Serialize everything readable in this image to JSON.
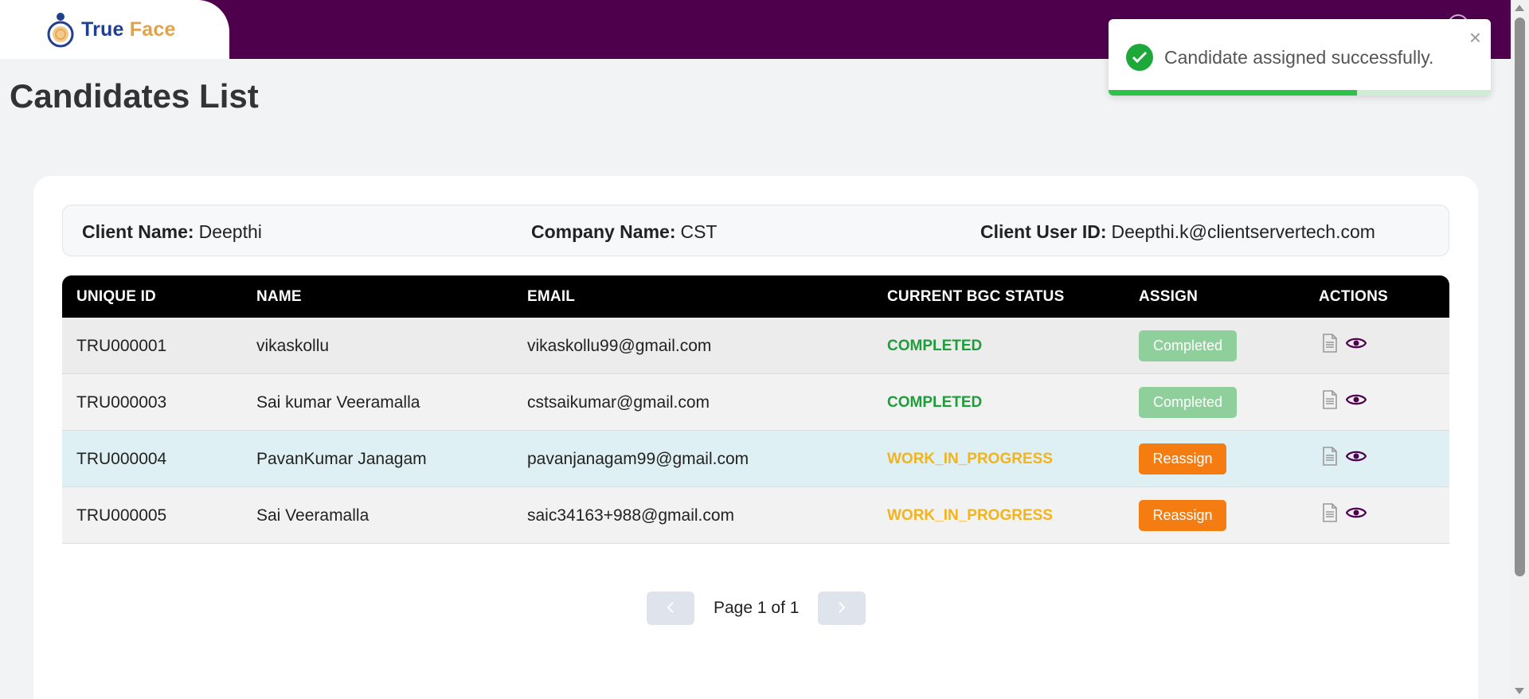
{
  "header": {
    "logo_true": "True",
    "logo_face": "Face"
  },
  "page_title": "Candidates List",
  "client_info": {
    "client_name_label": "Client Name:",
    "client_name": "Deepthi",
    "company_name_label": "Company Name:",
    "company_name": "CST",
    "client_user_id_label": "Client User ID:",
    "client_user_id": "Deepthi.k@clientservertech.com"
  },
  "table": {
    "columns": [
      "UNIQUE ID",
      "NAME",
      "EMAIL",
      "CURRENT BGC STATUS",
      "ASSIGN",
      "ACTIONS"
    ],
    "rows": [
      {
        "id": "TRU000001",
        "name": "vikaskollu",
        "email": "vikaskollu99@gmail.com",
        "status": "COMPLETED",
        "assign": "Completed"
      },
      {
        "id": "TRU000003",
        "name": "Sai kumar Veeramalla",
        "email": "cstsaikumar@gmail.com",
        "status": "COMPLETED",
        "assign": "Completed"
      },
      {
        "id": "TRU000004",
        "name": "PavanKumar Janagam",
        "email": "pavanjanagam99@gmail.com",
        "status": "WORK_IN_PROGRESS",
        "assign": "Reassign"
      },
      {
        "id": "TRU000005",
        "name": "Sai Veeramalla",
        "email": "saic34163+988@gmail.com",
        "status": "WORK_IN_PROGRESS",
        "assign": "Reassign"
      }
    ]
  },
  "pagination": {
    "text": "Page 1 of 1",
    "prev_icon": "chevron-left-icon",
    "next_icon": "chevron-right-icon"
  },
  "toast": {
    "message": "Candidate assigned successfully.",
    "close": "×",
    "progress": 0.65
  },
  "colors": {
    "header_bg": "#4e004d",
    "completed": "#1f9d3a",
    "wip": "#f3b31b",
    "reassign": "#f57c10",
    "completed_btn": "#8ecf9b"
  }
}
